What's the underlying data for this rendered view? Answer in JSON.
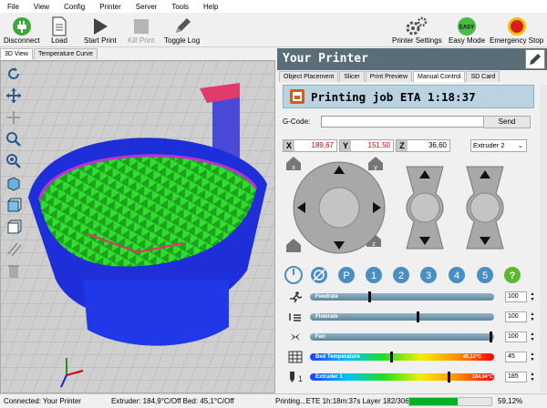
{
  "menu": [
    "File",
    "View",
    "Config",
    "Printer",
    "Server",
    "Tools",
    "Help"
  ],
  "toolbar": {
    "left": [
      {
        "label": "Disconnect",
        "icon": "power-plug-icon",
        "color": "#3da83a"
      },
      {
        "label": "Load",
        "icon": "document-icon"
      },
      {
        "label": "Start Print",
        "icon": "play-icon"
      },
      {
        "label": "Kill Print",
        "icon": "stop-icon",
        "disabled": true
      },
      {
        "label": "Toggle Log",
        "icon": "pencil-icon"
      }
    ],
    "right": [
      {
        "label": "Printer Settings",
        "icon": "gears-icon"
      },
      {
        "label": "Easy Mode",
        "icon": "easy-icon",
        "badge": "EASY"
      },
      {
        "label": "Emergency Stop",
        "icon": "emergency-stop-icon"
      }
    ]
  },
  "view_tabs": [
    "3D View",
    "Temperature Curve"
  ],
  "panel_title": "Your Printer",
  "panel_tabs": [
    "Object Placement",
    "Slicer",
    "Print Preview",
    "Manual Control",
    "SD Card"
  ],
  "active_panel_tab": "Manual Control",
  "job_status": "Printing job ETA 1:18:37",
  "gcode": {
    "label": "G-Code:",
    "value": "",
    "send": "Send"
  },
  "coords": {
    "x_label": "X",
    "x": "189,67",
    "y_label": "Y",
    "y": "151,50",
    "z_label": "Z",
    "z": "36,60"
  },
  "extruder_select": "Extruder 2",
  "macro_buttons": [
    "P",
    "1",
    "2",
    "3",
    "4",
    "5"
  ],
  "sliders": [
    {
      "name": "Feedrate",
      "value": "100",
      "knob_frac": 0.32
    },
    {
      "name": "Flowrate",
      "value": "100",
      "knob_frac": 0.59
    },
    {
      "name": "Fan",
      "value": "100",
      "knob_frac": 0.99
    }
  ],
  "temps": [
    {
      "name": "Bed Temperature",
      "current": "45,12°C",
      "target": "45",
      "knob_frac": 0.44
    },
    {
      "name": "Extruder 1",
      "current": "184,94°C",
      "target": "185",
      "knob_frac": 0.76
    }
  ],
  "status": {
    "connection": "Connected: Your Printer",
    "temps": "Extruder: 184,9°C/Off Bed: 45,1°C/Off",
    "print": "Printing...ETE 1h:18m:37s Layer 182/306",
    "progress_percent": 59,
    "percent_label": "59,12%"
  },
  "colors": {
    "title_bg": "#5a6e78",
    "job_bg": "#b9d3e1",
    "coord_red": "#cc0000",
    "macro_blue": "#4a8fc1",
    "help_green": "#5cb82e"
  }
}
